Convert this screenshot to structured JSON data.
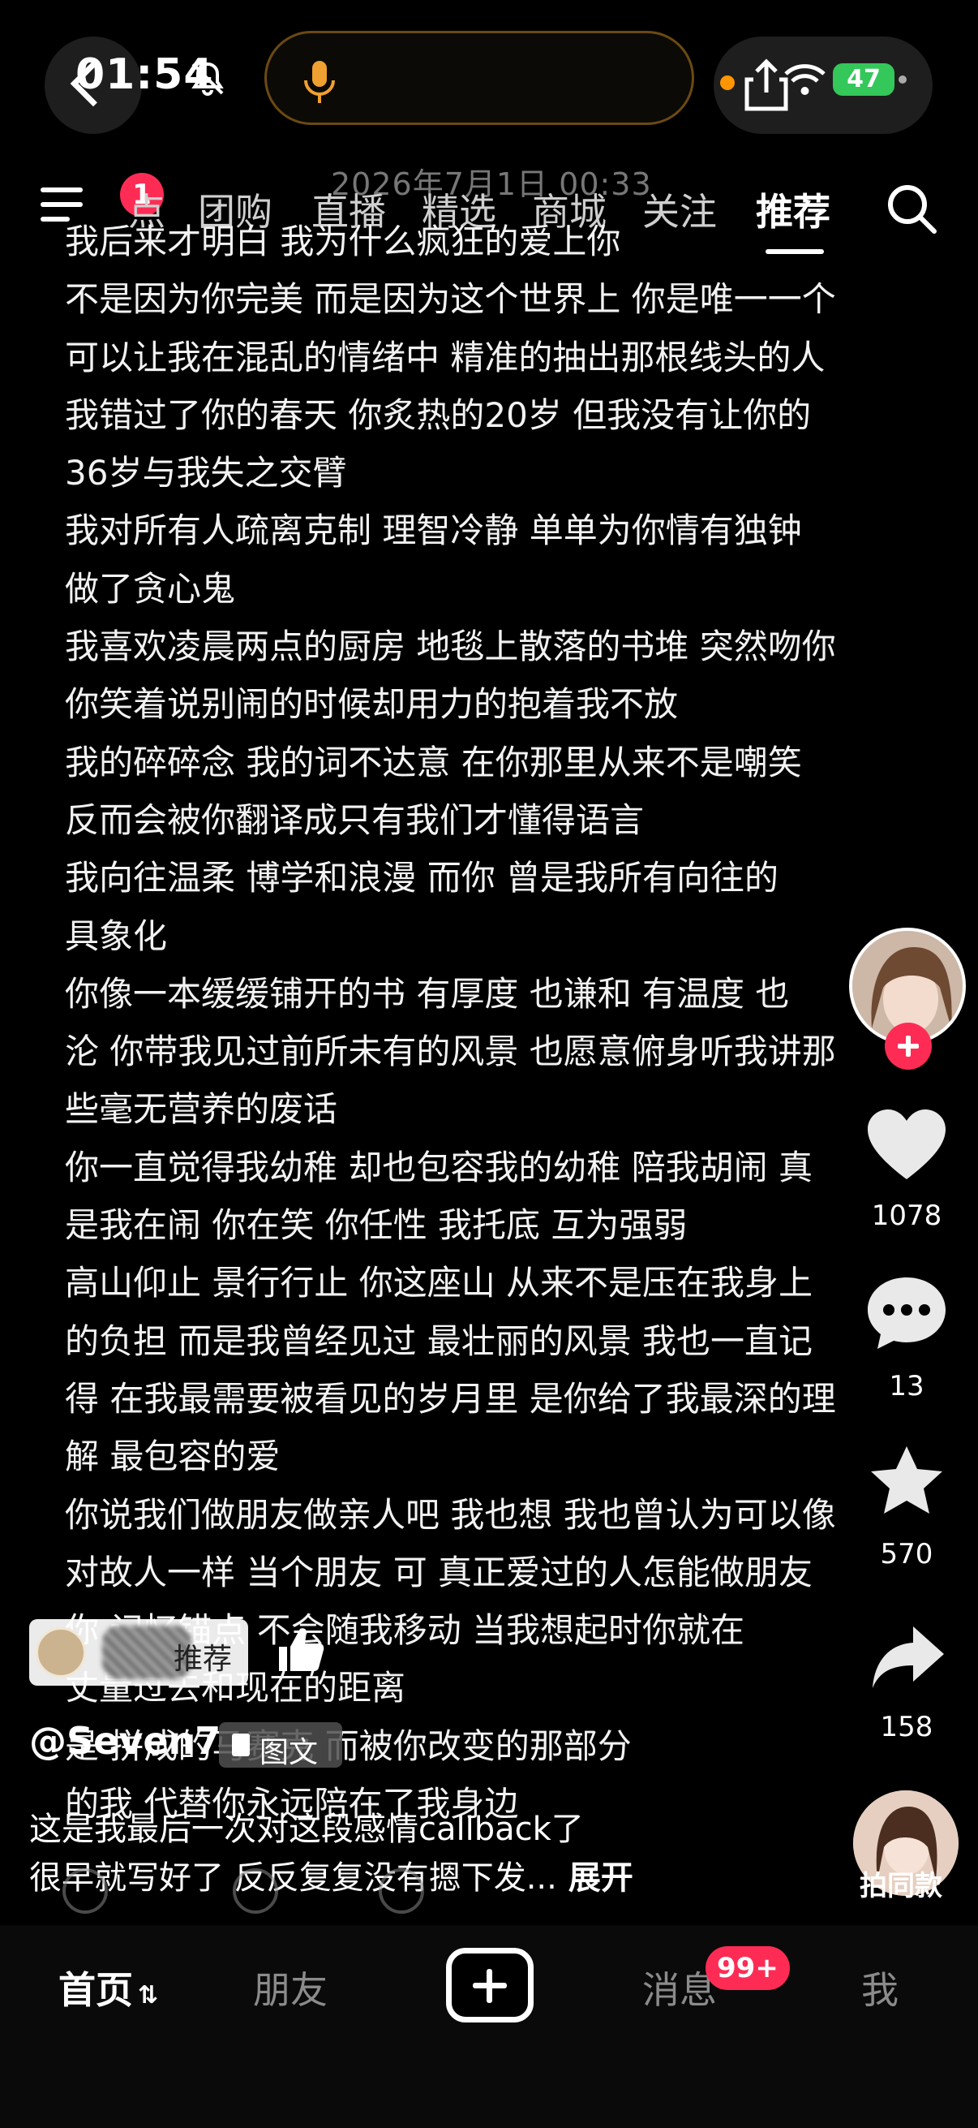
{
  "status_bar": {
    "time": "01:54",
    "battery": "47"
  },
  "watermark_date": "2026年7月1日 00:33",
  "top_nav": {
    "menu_badge": "1",
    "tabs": [
      "点",
      "团购",
      "直播",
      "精选",
      "商城",
      "关注",
      "推荐"
    ],
    "active_tab": "推荐"
  },
  "post": {
    "lines": [
      "我后来才明白 我为什么疯狂的爱上你",
      "不是因为你完美 而是因为这个世界上 你是唯一一个",
      "可以让我在混乱的情绪中 精准的抽出那根线头的人",
      "我错过了你的春天 你炙热的20岁 但我没有让你的",
      "36岁与我失之交臂",
      "我对所有人疏离克制 理智冷静 单单为你情有独钟",
      "做了贪心鬼",
      "我喜欢凌晨两点的厨房 地毯上散落的书堆 突然吻你",
      "你笑着说别闹的时候却用力的抱着我不放",
      "我的碎碎念 我的词不达意 在你那里从来不是嘲笑",
      "反而会被你翻译成只有我们才懂得语言",
      "我向往温柔 博学和浪漫 而你 曾是我所有向往的",
      "具象化",
      "你像一本缓缓铺开的书 有厚度 也谦和 有温度 也",
      "沦 你带我见过前所未有的风景 也愿意俯身听我讲那",
      "些毫无营养的废话",
      "你一直觉得我幼稚 却也包容我的幼稚 陪我胡闹 真",
      "是我在闹 你在笑 你任性 我托底 互为强弱",
      "高山仰止 景行行止 你这座山 从来不是压在我身上",
      "的负担 而是我曾经见过 最壮丽的风景 我也一直记",
      "得 在我最需要被看见的岁月里 是你给了我最深的理",
      "解 最包容的爱",
      "你说我们做朋友做亲人吧 我也想 我也曾认为可以像",
      "对故人一样 当个朋友 可 真正爱过的人怎能做朋友",
      "你 记忆锚点 不会随我移动 当我想起时你就在",
      "丈量过去和现在的距离",
      "是 拼成的马赛克 而被你改变的那部分",
      "的我 代替你永远陪在了我身边"
    ]
  },
  "rail": {
    "likes": "1078",
    "comments": "13",
    "favorites": "570",
    "shares": "158",
    "duet_label": "拍同款"
  },
  "author": {
    "recommend_label": "推荐",
    "name": "@Seven7",
    "post_type": "图文",
    "caption_line1": "这是我最后一次对这段感情callback了",
    "caption_line2": "很早就写好了 反反复复没有摁下发...",
    "expand_label": "展开"
  },
  "tab_bar": {
    "home": "首页",
    "friends": "朋友",
    "messages": "消息",
    "messages_badge": "99+",
    "me": "我"
  },
  "colors": {
    "accent": "#fe2c55",
    "background": "#000000",
    "battery": "#34c759"
  }
}
